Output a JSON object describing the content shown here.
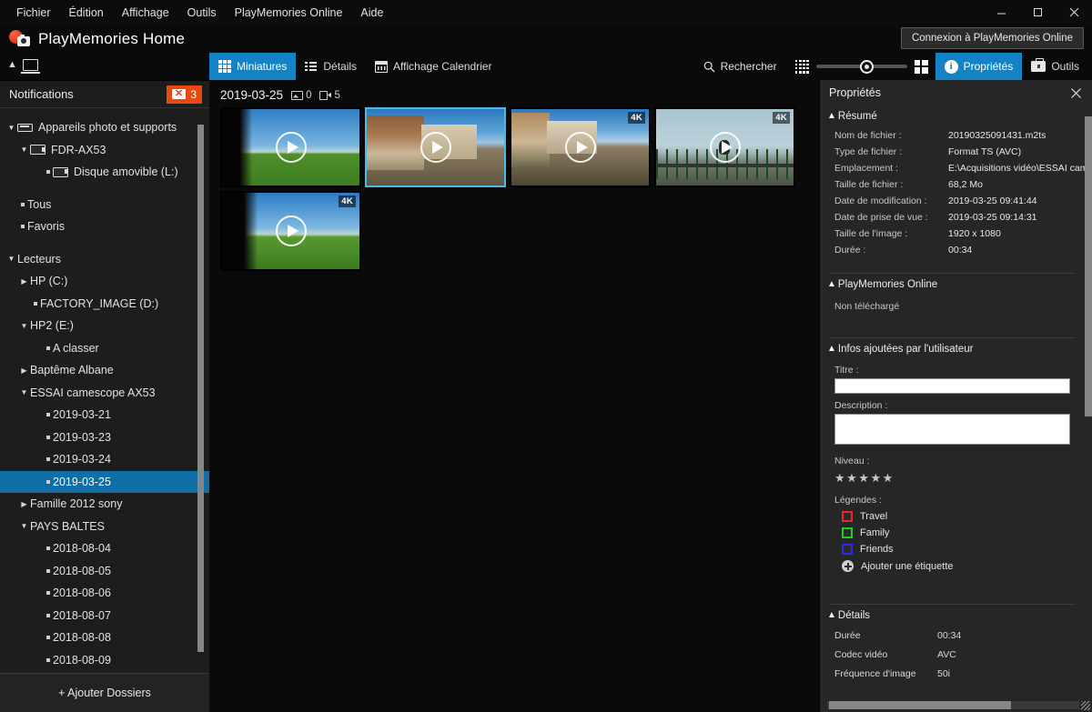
{
  "window": {
    "menus": [
      "Fichier",
      "Édition",
      "Affichage",
      "Outils",
      "PlayMemories Online",
      "Aide"
    ],
    "controls": {
      "minimize": "minimize-icon",
      "maximize": "maximize-icon",
      "close": "close-icon"
    },
    "app_title": "PlayMemories Home",
    "connect_button": "Connexion à PlayMemories Online"
  },
  "toolbar": {
    "view_modes": [
      {
        "label": "Miniatures",
        "icon": "thumbnails-grid-icon",
        "active": true
      },
      {
        "label": "Détails",
        "icon": "details-list-icon",
        "active": false
      },
      {
        "label": "Affichage Calendrier",
        "icon": "calendar-icon",
        "active": false
      }
    ],
    "search_label": "Rechercher",
    "search_icon": "search-icon",
    "zoom_small_icon": "small-thumbnails-icon",
    "zoom_large_icon": "large-thumbnails-icon",
    "zoom_value": 48,
    "properties_label": "Propriétés",
    "properties_icon": "info-icon",
    "properties_active": true,
    "tools_label": "Outils",
    "tools_icon": "toolbox-icon"
  },
  "sidebar": {
    "notifications_label": "Notifications",
    "notifications_count": "3",
    "add_folders_label": "+ Ajouter Dossiers",
    "tree": [
      {
        "label": "Appareils photo et supports",
        "indent": 0,
        "twisty": "down",
        "icon": "device-icon",
        "bullet": false,
        "selected": false
      },
      {
        "label": "FDR-AX53",
        "indent": 1,
        "twisty": "down",
        "icon": "camcorder-icon",
        "bullet": false,
        "selected": false
      },
      {
        "label": "Disque amovible (L:)",
        "indent": 2,
        "twisty": "none",
        "icon": "camcorder-icon",
        "bullet": true,
        "selected": false
      },
      {
        "label": "Tous",
        "indent": 0,
        "twisty": "none",
        "icon": "none",
        "bullet": true,
        "selected": false,
        "gap_before": true
      },
      {
        "label": "Favoris",
        "indent": 0,
        "twisty": "none",
        "icon": "none",
        "bullet": true,
        "selected": false
      },
      {
        "label": "Lecteurs",
        "indent": 0,
        "twisty": "down",
        "icon": "none",
        "bullet": false,
        "selected": false,
        "gap_before": true
      },
      {
        "label": "HP (C:)",
        "indent": 1,
        "twisty": "right",
        "icon": "none",
        "bullet": false,
        "selected": false
      },
      {
        "label": "FACTORY_IMAGE (D:)",
        "indent": 1,
        "twisty": "none",
        "icon": "none",
        "bullet": true,
        "selected": false
      },
      {
        "label": "HP2 (E:)",
        "indent": 1,
        "twisty": "down",
        "icon": "none",
        "bullet": false,
        "selected": false
      },
      {
        "label": "A classer",
        "indent": 2,
        "twisty": "none",
        "icon": "none",
        "bullet": true,
        "selected": false
      },
      {
        "label": "Baptême Albane",
        "indent": 1,
        "twisty": "right",
        "icon": "none",
        "bullet": false,
        "selected": false
      },
      {
        "label": "ESSAI camescope AX53",
        "indent": 1,
        "twisty": "down",
        "icon": "none",
        "bullet": false,
        "selected": false
      },
      {
        "label": "2019-03-21",
        "indent": 2,
        "twisty": "none",
        "icon": "none",
        "bullet": true,
        "selected": false
      },
      {
        "label": "2019-03-23",
        "indent": 2,
        "twisty": "none",
        "icon": "none",
        "bullet": true,
        "selected": false
      },
      {
        "label": "2019-03-24",
        "indent": 2,
        "twisty": "none",
        "icon": "none",
        "bullet": true,
        "selected": false
      },
      {
        "label": "2019-03-25",
        "indent": 2,
        "twisty": "none",
        "icon": "none",
        "bullet": true,
        "selected": true
      },
      {
        "label": "Famille 2012 sony",
        "indent": 1,
        "twisty": "right",
        "icon": "none",
        "bullet": false,
        "selected": false
      },
      {
        "label": "PAYS BALTES",
        "indent": 1,
        "twisty": "down",
        "icon": "none",
        "bullet": false,
        "selected": false
      },
      {
        "label": "2018-08-04",
        "indent": 2,
        "twisty": "none",
        "icon": "none",
        "bullet": true,
        "selected": false
      },
      {
        "label": "2018-08-05",
        "indent": 2,
        "twisty": "none",
        "icon": "none",
        "bullet": true,
        "selected": false
      },
      {
        "label": "2018-08-06",
        "indent": 2,
        "twisty": "none",
        "icon": "none",
        "bullet": true,
        "selected": false
      },
      {
        "label": "2018-08-07",
        "indent": 2,
        "twisty": "none",
        "icon": "none",
        "bullet": true,
        "selected": false
      },
      {
        "label": "2018-08-08",
        "indent": 2,
        "twisty": "none",
        "icon": "none",
        "bullet": true,
        "selected": false
      },
      {
        "label": "2018-08-09",
        "indent": 2,
        "twisty": "none",
        "icon": "none",
        "bullet": true,
        "selected": false
      }
    ]
  },
  "content": {
    "group_date": "2019-03-25",
    "photo_count": "0",
    "video_count": "5",
    "thumbnails": [
      {
        "scene": "sc-field",
        "badge": "",
        "selected": false
      },
      {
        "scene": "sc-house",
        "badge": "",
        "selected": true
      },
      {
        "scene": "sc-house2",
        "badge": "4K",
        "selected": false
      },
      {
        "scene": "sc-fence",
        "badge": "4K",
        "selected": false
      },
      {
        "scene": "sc-field2",
        "badge": "4K",
        "selected": false
      }
    ]
  },
  "properties": {
    "title": "Propriétés",
    "close_icon": "close-icon",
    "summary": {
      "heading": "Résumé",
      "rows": [
        {
          "key": "Nom de fichier :",
          "value": "20190325091431.m2ts"
        },
        {
          "key": "Type de fichier :",
          "value": "Format TS (AVC)"
        },
        {
          "key": "Emplacement :",
          "value": "E:\\Acquisitions vidéo\\ESSAI camescope A."
        },
        {
          "key": "Taille de fichier :",
          "value": "68,2 Mo"
        },
        {
          "key": "Date de modification :",
          "value": "2019-03-25 09:41:44"
        },
        {
          "key": "Date de prise de vue :",
          "value": "2019-03-25 09:14:31"
        },
        {
          "key": "Taille de l'image :",
          "value": "1920 x 1080"
        },
        {
          "key": "Durée :",
          "value": "00:34"
        }
      ]
    },
    "online": {
      "heading": "PlayMemories Online",
      "status": "Non téléchargé"
    },
    "user_info": {
      "heading": "Infos ajoutées par l'utilisateur",
      "title_label": "Titre :",
      "title_value": "",
      "description_label": "Description :",
      "description_value": "",
      "level_label": "Niveau :",
      "stars": "★★★★★",
      "rating": 0,
      "tags_label": "Légendes :",
      "tags": [
        {
          "label": "Travel",
          "color": "#ee2222"
        },
        {
          "label": "Family",
          "color": "#1fd01f"
        },
        {
          "label": "Friends",
          "color": "#2a2aee"
        }
      ],
      "add_tag_label": "Ajouter une étiquette",
      "add_tag_icon": "plus-circle-icon"
    },
    "details": {
      "heading": "Détails",
      "rows": [
        {
          "key": "Durée",
          "value": "00:34"
        },
        {
          "key": "Codec vidéo",
          "value": "AVC"
        },
        {
          "key": "Fréquence d'image",
          "value": "50i"
        }
      ]
    }
  },
  "colors": {
    "accent": "#1383c6",
    "selection": "#0e6ea5",
    "badge": "#e8490f",
    "panel": "#262626",
    "sidebar": "#1d1d1d"
  }
}
